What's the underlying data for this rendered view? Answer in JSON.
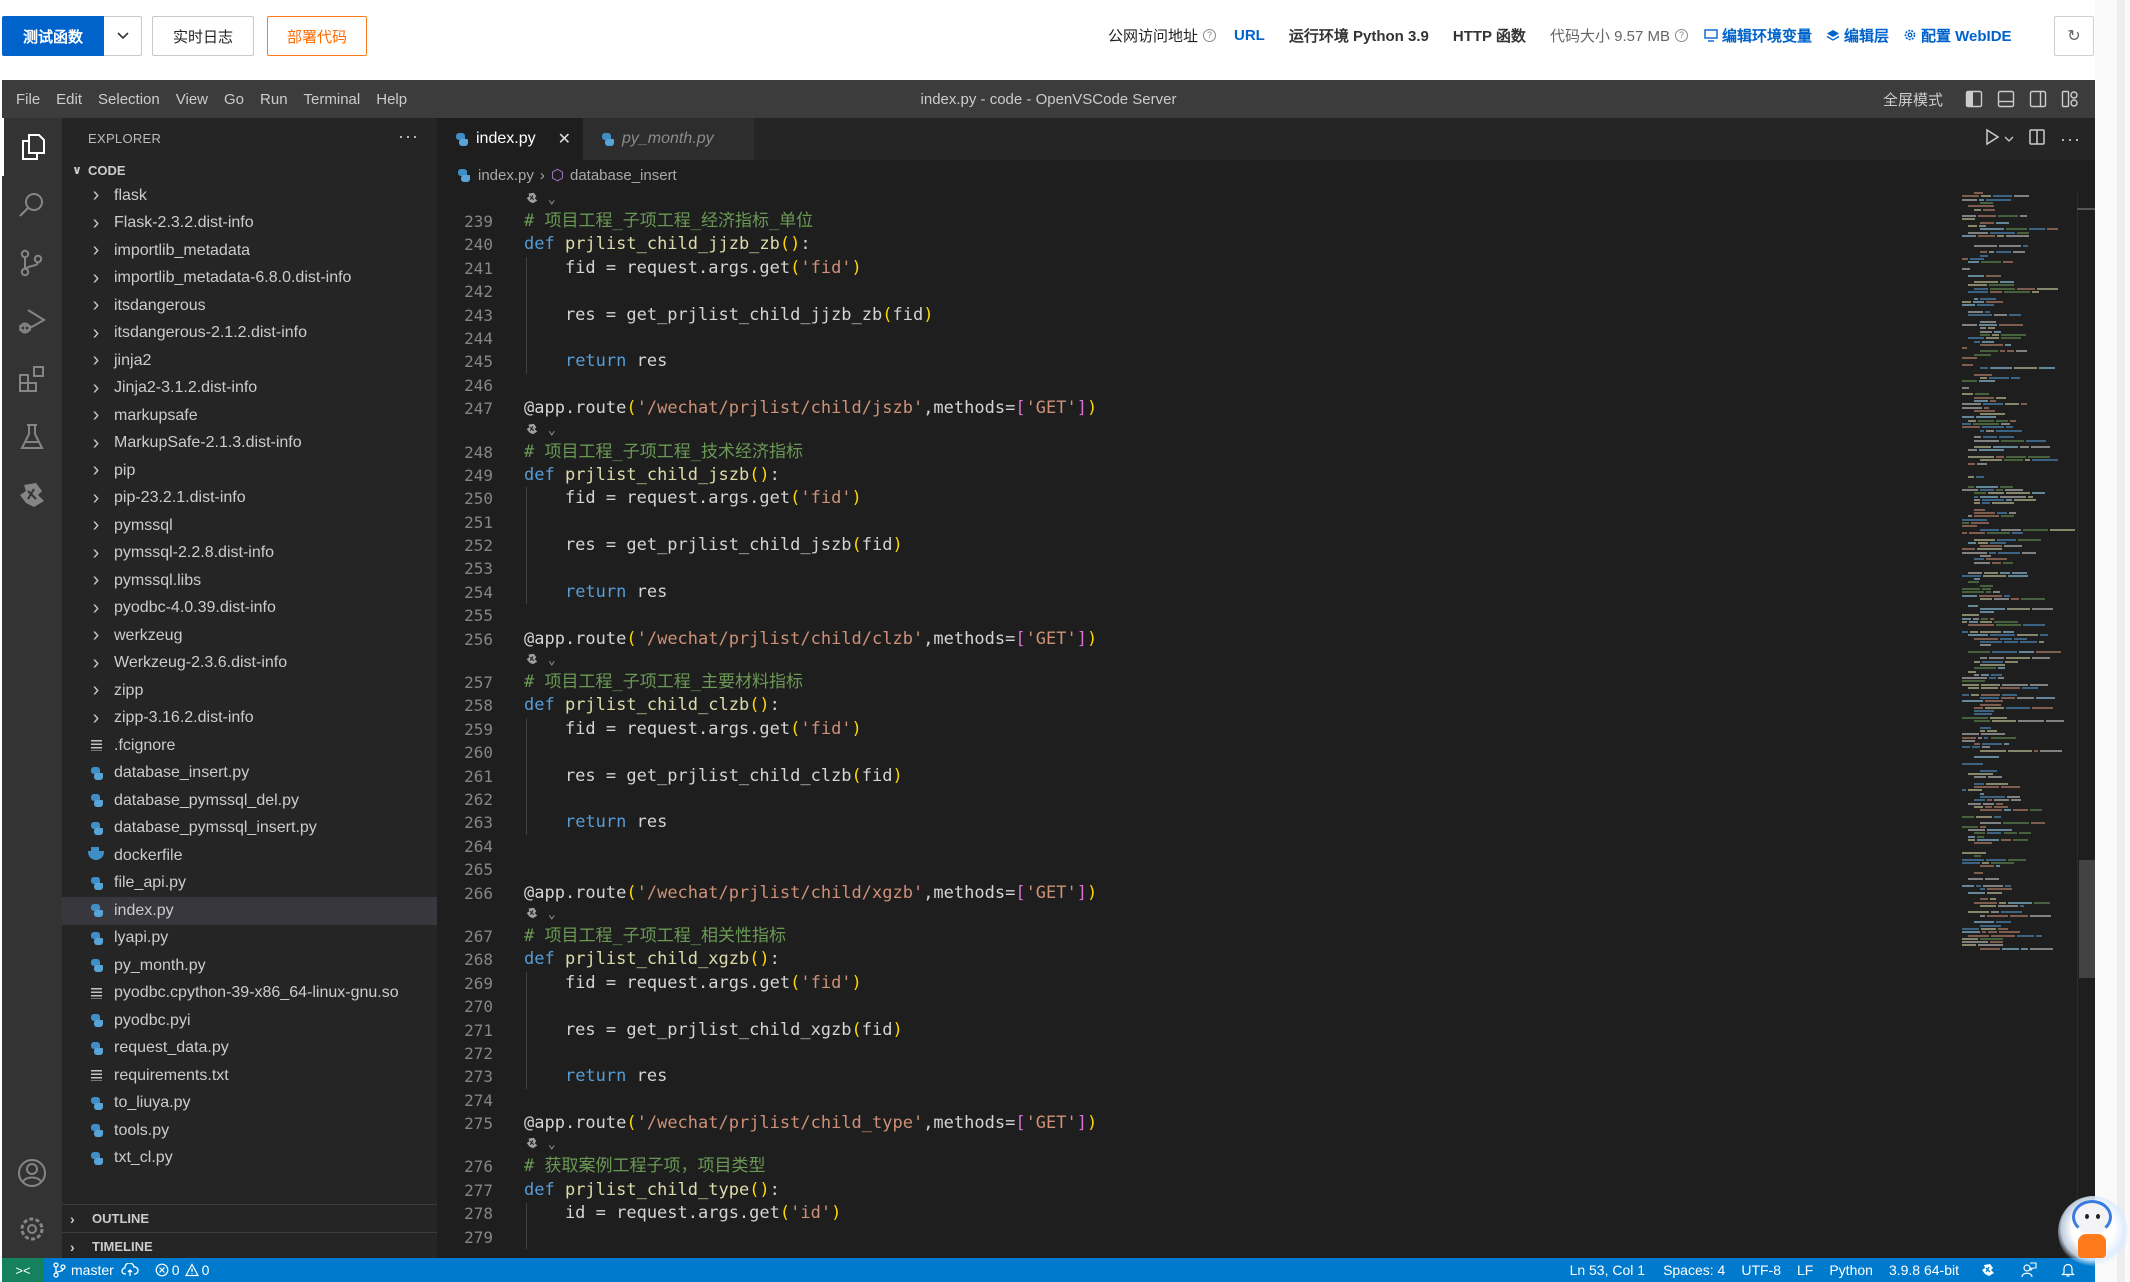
{
  "header": {
    "test_button": "测试函数",
    "log_button": "实时日志",
    "deploy_button": "部署代码",
    "public_url_label": "公网访问地址",
    "url_link": "URL",
    "runtime": "运行环境 Python 3.9",
    "function_type": "HTTP 函数",
    "code_size": "代码大小 9.57 MB",
    "edit_env_vars": "编辑环境变量",
    "edit_layer": "编辑层",
    "config_webide": "配置 WebIDE",
    "help_glyph": "?",
    "refresh_glyph": "↻"
  },
  "vscode": {
    "menu": [
      "File",
      "Edit",
      "Selection",
      "View",
      "Go",
      "Run",
      "Terminal",
      "Help"
    ],
    "window_title": "index.py - code - OpenVSCode Server",
    "fullscreen_label": "全屏模式"
  },
  "sidebar": {
    "title": "EXPLORER",
    "more": "···",
    "root": "CODE",
    "items": [
      {
        "label": "flask",
        "type": "folder"
      },
      {
        "label": "Flask-2.3.2.dist-info",
        "type": "folder"
      },
      {
        "label": "importlib_metadata",
        "type": "folder"
      },
      {
        "label": "importlib_metadata-6.8.0.dist-info",
        "type": "folder"
      },
      {
        "label": "itsdangerous",
        "type": "folder"
      },
      {
        "label": "itsdangerous-2.1.2.dist-info",
        "type": "folder"
      },
      {
        "label": "jinja2",
        "type": "folder"
      },
      {
        "label": "Jinja2-3.1.2.dist-info",
        "type": "folder"
      },
      {
        "label": "markupsafe",
        "type": "folder"
      },
      {
        "label": "MarkupSafe-2.1.3.dist-info",
        "type": "folder"
      },
      {
        "label": "pip",
        "type": "folder"
      },
      {
        "label": "pip-23.2.1.dist-info",
        "type": "folder"
      },
      {
        "label": "pymssql",
        "type": "folder"
      },
      {
        "label": "pymssql-2.2.8.dist-info",
        "type": "folder"
      },
      {
        "label": "pymssql.libs",
        "type": "folder"
      },
      {
        "label": "pyodbc-4.0.39.dist-info",
        "type": "folder"
      },
      {
        "label": "werkzeug",
        "type": "folder"
      },
      {
        "label": "Werkzeug-2.3.6.dist-info",
        "type": "folder"
      },
      {
        "label": "zipp",
        "type": "folder"
      },
      {
        "label": "zipp-3.16.2.dist-info",
        "type": "folder"
      },
      {
        "label": ".fcignore",
        "type": "text"
      },
      {
        "label": "database_insert.py",
        "type": "python"
      },
      {
        "label": "database_pymssql_del.py",
        "type": "python"
      },
      {
        "label": "database_pymssql_insert.py",
        "type": "python"
      },
      {
        "label": "dockerfile",
        "type": "docker"
      },
      {
        "label": "file_api.py",
        "type": "python"
      },
      {
        "label": "index.py",
        "type": "python",
        "selected": true
      },
      {
        "label": "lyapi.py",
        "type": "python"
      },
      {
        "label": "py_month.py",
        "type": "python"
      },
      {
        "label": "pyodbc.cpython-39-x86_64-linux-gnu.so",
        "type": "text"
      },
      {
        "label": "pyodbc.pyi",
        "type": "python"
      },
      {
        "label": "request_data.py",
        "type": "python"
      },
      {
        "label": "requirements.txt",
        "type": "text"
      },
      {
        "label": "to_liuya.py",
        "type": "python"
      },
      {
        "label": "tools.py",
        "type": "python"
      },
      {
        "label": "txt_cl.py",
        "type": "python"
      }
    ],
    "outline": "OUTLINE",
    "timeline": "TIMELINE"
  },
  "editor": {
    "tabs": [
      {
        "label": "index.py",
        "active": true
      },
      {
        "label": "py_month.py",
        "active": false
      }
    ],
    "breadcrumb": {
      "file": "index.py",
      "symbol": "database_insert"
    },
    "lines": [
      {
        "codelens": true
      },
      {
        "n": "239",
        "tokens": [
          [
            "c-com",
            "# 项目工程_子项工程_经济指标_单位"
          ]
        ]
      },
      {
        "n": "240",
        "tokens": [
          [
            "c-kw",
            "def "
          ],
          [
            "c-fn",
            "prjlist_child_jjzb_zb"
          ],
          [
            "c-br1",
            "()"
          ],
          [
            "c-plain",
            ":"
          ]
        ]
      },
      {
        "n": "241",
        "tokens": [
          [
            "c-plain",
            "    fid = request.args.get"
          ],
          [
            "c-br1",
            "("
          ],
          [
            "c-str",
            "'fid'"
          ],
          [
            "c-br1",
            ")"
          ]
        ],
        "indent": true
      },
      {
        "n": "242",
        "tokens": [],
        "indent": true
      },
      {
        "n": "243",
        "tokens": [
          [
            "c-plain",
            "    res = get_prjlist_child_jjzb_zb"
          ],
          [
            "c-br1",
            "("
          ],
          [
            "c-plain",
            "fid"
          ],
          [
            "c-br1",
            ")"
          ]
        ],
        "indent": true
      },
      {
        "n": "244",
        "tokens": [],
        "indent": true
      },
      {
        "n": "245",
        "tokens": [
          [
            "c-plain",
            "    "
          ],
          [
            "c-ret",
            "return"
          ],
          [
            "c-plain",
            " res"
          ]
        ],
        "indent": true
      },
      {
        "n": "246",
        "tokens": []
      },
      {
        "n": "247",
        "tokens": [
          [
            "c-plain",
            "@app.route"
          ],
          [
            "c-br1",
            "("
          ],
          [
            "c-str",
            "'/wechat/prjlist/child/jszb'"
          ],
          [
            "c-plain",
            ",methods="
          ],
          [
            "c-br2",
            "["
          ],
          [
            "c-str",
            "'GET'"
          ],
          [
            "c-br2",
            "]"
          ],
          [
            "c-br1",
            ")"
          ]
        ]
      },
      {
        "codelens": true
      },
      {
        "n": "248",
        "tokens": [
          [
            "c-com",
            "# 项目工程_子项工程_技术经济指标"
          ]
        ]
      },
      {
        "n": "249",
        "tokens": [
          [
            "c-kw",
            "def "
          ],
          [
            "c-fn",
            "prjlist_child_jszb"
          ],
          [
            "c-br1",
            "()"
          ],
          [
            "c-plain",
            ":"
          ]
        ]
      },
      {
        "n": "250",
        "tokens": [
          [
            "c-plain",
            "    fid = request.args.get"
          ],
          [
            "c-br1",
            "("
          ],
          [
            "c-str",
            "'fid'"
          ],
          [
            "c-br1",
            ")"
          ]
        ],
        "indent": true
      },
      {
        "n": "251",
        "tokens": [],
        "indent": true
      },
      {
        "n": "252",
        "tokens": [
          [
            "c-plain",
            "    res = get_prjlist_child_jszb"
          ],
          [
            "c-br1",
            "("
          ],
          [
            "c-plain",
            "fid"
          ],
          [
            "c-br1",
            ")"
          ]
        ],
        "indent": true
      },
      {
        "n": "253",
        "tokens": [],
        "indent": true
      },
      {
        "n": "254",
        "tokens": [
          [
            "c-plain",
            "    "
          ],
          [
            "c-ret",
            "return"
          ],
          [
            "c-plain",
            " res"
          ]
        ],
        "indent": true
      },
      {
        "n": "255",
        "tokens": []
      },
      {
        "n": "256",
        "tokens": [
          [
            "c-plain",
            "@app.route"
          ],
          [
            "c-br1",
            "("
          ],
          [
            "c-str",
            "'/wechat/prjlist/child/clzb'"
          ],
          [
            "c-plain",
            ",methods="
          ],
          [
            "c-br2",
            "["
          ],
          [
            "c-str",
            "'GET'"
          ],
          [
            "c-br2",
            "]"
          ],
          [
            "c-br1",
            ")"
          ]
        ]
      },
      {
        "codelens": true
      },
      {
        "n": "257",
        "tokens": [
          [
            "c-com",
            "# 项目工程_子项工程_主要材料指标"
          ]
        ]
      },
      {
        "n": "258",
        "tokens": [
          [
            "c-kw",
            "def "
          ],
          [
            "c-fn",
            "prjlist_child_clzb"
          ],
          [
            "c-br1",
            "()"
          ],
          [
            "c-plain",
            ":"
          ]
        ]
      },
      {
        "n": "259",
        "tokens": [
          [
            "c-plain",
            "    fid = request.args.get"
          ],
          [
            "c-br1",
            "("
          ],
          [
            "c-str",
            "'fid'"
          ],
          [
            "c-br1",
            ")"
          ]
        ],
        "indent": true
      },
      {
        "n": "260",
        "tokens": [],
        "indent": true
      },
      {
        "n": "261",
        "tokens": [
          [
            "c-plain",
            "    res = get_prjlist_child_clzb"
          ],
          [
            "c-br1",
            "("
          ],
          [
            "c-plain",
            "fid"
          ],
          [
            "c-br1",
            ")"
          ]
        ],
        "indent": true
      },
      {
        "n": "262",
        "tokens": [],
        "indent": true
      },
      {
        "n": "263",
        "tokens": [
          [
            "c-plain",
            "    "
          ],
          [
            "c-ret",
            "return"
          ],
          [
            "c-plain",
            " res"
          ]
        ],
        "indent": true
      },
      {
        "n": "264",
        "tokens": []
      },
      {
        "n": "265",
        "tokens": []
      },
      {
        "n": "266",
        "tokens": [
          [
            "c-plain",
            "@app.route"
          ],
          [
            "c-br1",
            "("
          ],
          [
            "c-str",
            "'/wechat/prjlist/child/xgzb'"
          ],
          [
            "c-plain",
            ",methods="
          ],
          [
            "c-br2",
            "["
          ],
          [
            "c-str",
            "'GET'"
          ],
          [
            "c-br2",
            "]"
          ],
          [
            "c-br1",
            ")"
          ]
        ]
      },
      {
        "codelens": true
      },
      {
        "n": "267",
        "tokens": [
          [
            "c-com",
            "# 项目工程_子项工程_相关性指标"
          ]
        ]
      },
      {
        "n": "268",
        "tokens": [
          [
            "c-kw",
            "def "
          ],
          [
            "c-fn",
            "prjlist_child_xgzb"
          ],
          [
            "c-br1",
            "()"
          ],
          [
            "c-plain",
            ":"
          ]
        ]
      },
      {
        "n": "269",
        "tokens": [
          [
            "c-plain",
            "    fid = request.args.get"
          ],
          [
            "c-br1",
            "("
          ],
          [
            "c-str",
            "'fid'"
          ],
          [
            "c-br1",
            ")"
          ]
        ],
        "indent": true
      },
      {
        "n": "270",
        "tokens": [],
        "indent": true
      },
      {
        "n": "271",
        "tokens": [
          [
            "c-plain",
            "    res = get_prjlist_child_xgzb"
          ],
          [
            "c-br1",
            "("
          ],
          [
            "c-plain",
            "fid"
          ],
          [
            "c-br1",
            ")"
          ]
        ],
        "indent": true
      },
      {
        "n": "272",
        "tokens": [],
        "indent": true
      },
      {
        "n": "273",
        "tokens": [
          [
            "c-plain",
            "    "
          ],
          [
            "c-ret",
            "return"
          ],
          [
            "c-plain",
            " res"
          ]
        ],
        "indent": true
      },
      {
        "n": "274",
        "tokens": []
      },
      {
        "n": "275",
        "tokens": [
          [
            "c-plain",
            "@app.route"
          ],
          [
            "c-br1",
            "("
          ],
          [
            "c-str",
            "'/wechat/prjlist/child_type'"
          ],
          [
            "c-plain",
            ",methods="
          ],
          [
            "c-br2",
            "["
          ],
          [
            "c-str",
            "'GET'"
          ],
          [
            "c-br2",
            "]"
          ],
          [
            "c-br1",
            ")"
          ]
        ]
      },
      {
        "codelens": true
      },
      {
        "n": "276",
        "tokens": [
          [
            "c-com",
            "# 获取案例工程子项，项目类型"
          ]
        ]
      },
      {
        "n": "277",
        "tokens": [
          [
            "c-kw",
            "def "
          ],
          [
            "c-fn",
            "prjlist_child_type"
          ],
          [
            "c-br1",
            "()"
          ],
          [
            "c-plain",
            ":"
          ]
        ]
      },
      {
        "n": "278",
        "tokens": [
          [
            "c-plain",
            "    id = request.args.get"
          ],
          [
            "c-br1",
            "("
          ],
          [
            "c-str",
            "'id'"
          ],
          [
            "c-br1",
            ")"
          ]
        ],
        "indent": true
      },
      {
        "n": "279",
        "tokens": [],
        "indent": true
      }
    ]
  },
  "statusbar": {
    "remote": "><",
    "branch": "master",
    "errors": "0",
    "warnings": "0",
    "cursor": "Ln 53, Col 1",
    "spaces": "Spaces: 4",
    "encoding": "UTF-8",
    "eol": "LF",
    "language": "Python",
    "interpreter": "3.9.8 64-bit"
  },
  "colors": {
    "primary_button": "#0063cc",
    "deploy_orange": "#ff6a00",
    "statusbar_blue": "#007acc",
    "remote_green": "#16825d"
  }
}
